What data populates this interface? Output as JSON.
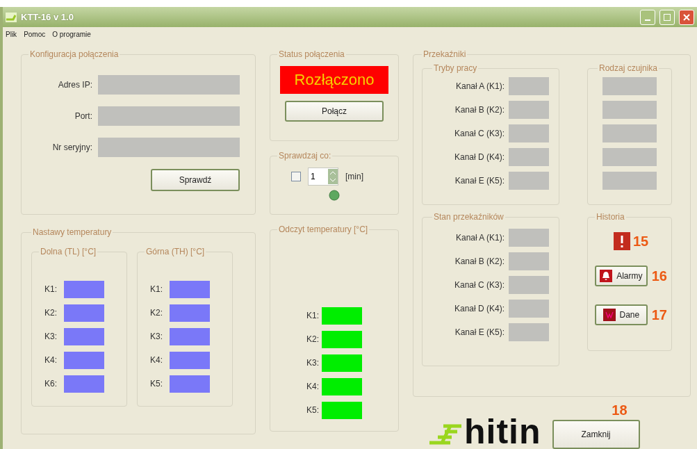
{
  "window": {
    "title": "KTT-16 v 1.0"
  },
  "menu": [
    {
      "label": "Plik"
    },
    {
      "label": "Pomoc"
    },
    {
      "label": "O programie"
    }
  ],
  "connection_config": {
    "title": "Konfiguracja połączenia",
    "fields": [
      {
        "label": "Adres IP:"
      },
      {
        "label": "Port:"
      },
      {
        "label": "Nr seryjny:"
      }
    ],
    "button": "Sprawdź"
  },
  "connection_status": {
    "title": "Status połączenia",
    "connected": false,
    "status": "Rozłączono",
    "button": "Połącz"
  },
  "check_interval": {
    "title": "Sprawdzaj co:",
    "checked": false,
    "value": "1",
    "unit": "[min]"
  },
  "temperature_setpoints": {
    "title": "Nastawy temperatury",
    "groups": [
      {
        "title": "Dolna (TL) [°C]",
        "rows": [
          "K1:",
          "K2:",
          "K3:",
          "K4:",
          "K6:"
        ]
      },
      {
        "title": "Górna (TH) [°C]",
        "rows": [
          "K1:",
          "K2:",
          "K3:",
          "K4:",
          "K5:"
        ]
      }
    ]
  },
  "temperature_readout": {
    "title": "Odczyt temperatury [°C]",
    "rows": [
      "K1:",
      "K2:",
      "K3:",
      "K4:",
      "K5:"
    ]
  },
  "relays": {
    "title": "Przekaźniki",
    "modes": {
      "title": "Tryby pracy",
      "rows": [
        "Kanał A (K1):",
        "Kanał B (K2):",
        "Kanał C (K3):",
        "Kanał D (K4):",
        "Kanał E (K5):"
      ]
    },
    "sensor_type": {
      "title": "Rodzaj czujnika"
    },
    "states": {
      "title": "Stan przekaźników",
      "rows": [
        "Kanał A (K1):",
        "Kanał B (K2):",
        "Kanał C (K3):",
        "Kanał D (K4):",
        "Kanał E (K5):"
      ]
    },
    "history": {
      "title": "Historia",
      "alert_annotation": "15",
      "buttons": [
        {
          "kind": "alarm",
          "label": "Alarmy",
          "annotation": "16"
        },
        {
          "kind": "data",
          "label": "Dane",
          "annotation": "17"
        }
      ]
    }
  },
  "logo": {
    "text": "hitin"
  },
  "close_button": {
    "label": "Zamknij",
    "annotation": "18"
  }
}
